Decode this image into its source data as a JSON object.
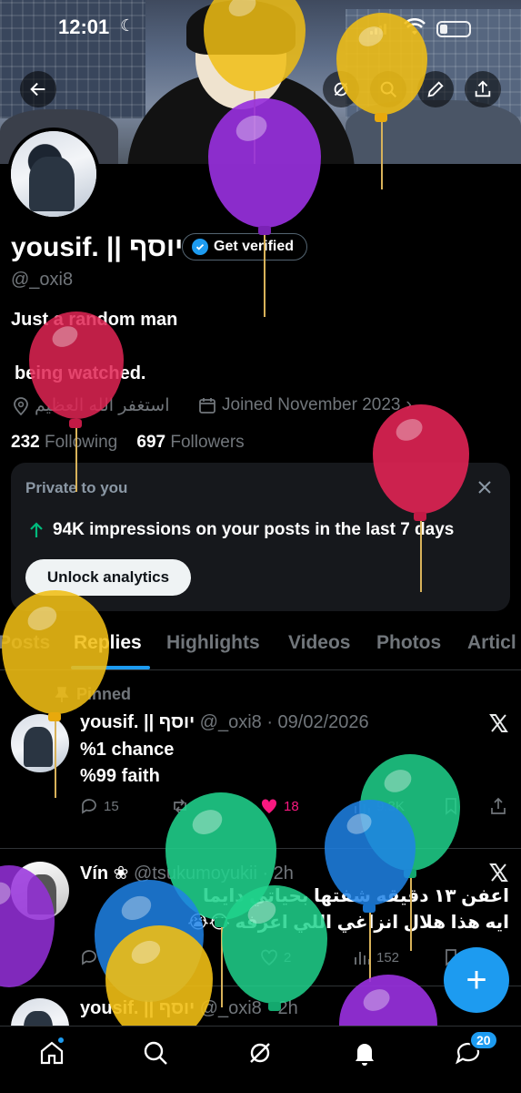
{
  "status_bar": {
    "time": "12:01"
  },
  "profile": {
    "display_name": "yousif. || יוסף",
    "get_verified_label": "Get verified",
    "handle": "@_oxi8",
    "bio_line1": "Just a random man",
    "bio_line2": "being watched.",
    "location": "استغفر الله العظيم",
    "joined": "Joined November 2023",
    "following_count": "232",
    "following_label": "Following",
    "followers_count": "697",
    "followers_label": "Followers"
  },
  "analytics_card": {
    "title": "Private to you",
    "stat": "94K impressions on your posts in the last 7 days",
    "button_label": "Unlock analytics"
  },
  "tabs": [
    {
      "label": "Posts"
    },
    {
      "label": "Replies"
    },
    {
      "label": "Highlights"
    },
    {
      "label": "Videos"
    },
    {
      "label": "Photos"
    },
    {
      "label": "Articl"
    }
  ],
  "posts": [
    {
      "pinned_label": "Pinned",
      "name": "yousif. || יוסף",
      "meta": "@_oxi8 · 09/02/2026",
      "text_line1": "%1 chance",
      "text_line2": "%99 faith",
      "replies": "15",
      "likes": "18",
      "views": "9.3K"
    },
    {
      "name": "Vín ❀",
      "meta": "@tsukumoyukii · 2h",
      "text_line1": "اعفن ١٣ دقيقه شفتها بحياتي دايما",
      "text_line2": "ايه هذا هلال انزاغي اللي اعرفه 😭😭",
      "likes": "2",
      "views": "152"
    },
    {
      "name": "yousif. || יוסף",
      "meta": "@_oxi8 · 2h"
    }
  ],
  "nav": {
    "messages_badge": "20"
  },
  "colors": {
    "accent": "#1d9bf0",
    "like": "#f91880",
    "green_arrow": "#00ba7c"
  }
}
